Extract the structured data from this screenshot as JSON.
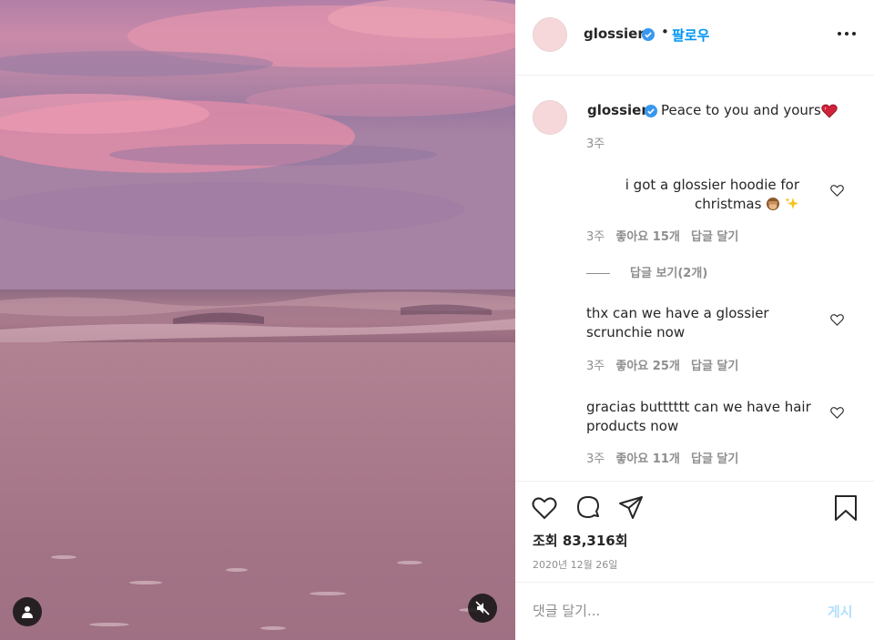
{
  "post": {
    "username": "glossier",
    "follow_label": "팔로우",
    "separator": "•",
    "caption": "Peace to you and yours",
    "caption_time": "3주",
    "views": "조회 83,316회",
    "date": "2020년 12월 26일",
    "verified_color": "#3897f0",
    "accent_color": "#0095f6"
  },
  "comments": [
    {
      "text": "i got a glossier hoodie for christmas",
      "time": "3주",
      "likes": "좋아요 15개",
      "reply_label": "답글 달기",
      "view_replies": "답글 보기(2개)"
    },
    {
      "text": "thx can we have a glossier scrunchie now",
      "time": "3주",
      "likes": "좋아요 25개",
      "reply_label": "답글 달기"
    },
    {
      "text": "gracias butttttt can we have hair products now",
      "time": "3주",
      "likes": "좋아요 11개",
      "reply_label": "답글 달기"
    }
  ],
  "composer": {
    "placeholder": "댓글 달기...",
    "post_label": "게시"
  },
  "icons": {
    "more": "more-options-icon",
    "like": "heart-icon",
    "comment": "comment-icon",
    "share": "paper-plane-icon",
    "save": "bookmark-icon",
    "tag": "user-tag-icon",
    "mute": "volume-muted-icon"
  }
}
